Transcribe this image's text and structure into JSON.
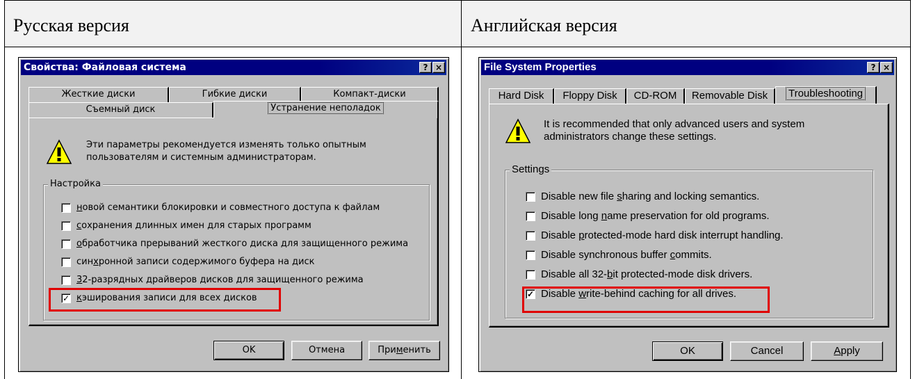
{
  "columns": {
    "left_header": "Русская версия",
    "right_header": "Английская версия"
  },
  "ru": {
    "title": "Свойства: Файловая система",
    "help_button": "?",
    "close_button": "×",
    "tabs_row1": [
      "Жесткие диски",
      "Гибкие диски",
      "Компакт-диски"
    ],
    "tabs_row2": [
      "Съемный диск",
      "Устранение неполадок"
    ],
    "warning_line1": "Эти параметры рекомендуется изменять только опытным",
    "warning_line2": "пользователям и системным администраторам.",
    "group_label": "Настройка",
    "options": [
      {
        "pre": "",
        "u": "н",
        "post": "овой семантики блокировки и совместного доступа к файлам",
        "checked": false
      },
      {
        "pre": "",
        "u": "с",
        "post": "охранения длинных имен для старых программ",
        "checked": false
      },
      {
        "pre": "",
        "u": "о",
        "post": "бработчика прерываний жесткого диска для защищенного режима",
        "checked": false
      },
      {
        "pre": "син",
        "u": "х",
        "post": "ронной записи содержимого буфера на диск",
        "checked": false
      },
      {
        "pre": "",
        "u": "3",
        "post": "2-разрядных драйверов дисков для защищенного режима",
        "checked": false
      },
      {
        "pre": "",
        "u": "к",
        "post": "эширования записи для всех дисков",
        "checked": true
      }
    ],
    "buttons": {
      "ok": "OK",
      "cancel": "Отмена",
      "apply_pre": "При",
      "apply_u": "м",
      "apply_post": "енить"
    }
  },
  "en": {
    "title": "File System Properties",
    "help_button": "?",
    "close_button": "×",
    "tabs": [
      "Hard Disk",
      "Floppy Disk",
      "CD-ROM",
      "Removable Disk",
      "Troubleshooting"
    ],
    "warning_line1": "It is recommended that only advanced users and system",
    "warning_line2": "administrators change these settings.",
    "group_label": "Settings",
    "options": [
      {
        "pre": "Disable new file ",
        "u": "s",
        "post": "haring and locking semantics.",
        "checked": false
      },
      {
        "pre": "Disable long ",
        "u": "n",
        "post": "ame preservation for old programs.",
        "checked": false
      },
      {
        "pre": "Disable ",
        "u": "p",
        "post": "rotected-mode hard disk interrupt handling.",
        "checked": false
      },
      {
        "pre": "Disable synchronous buffer ",
        "u": "c",
        "post": "ommits.",
        "checked": false
      },
      {
        "pre": "Disable all 32-",
        "u": "b",
        "post": "it protected-mode disk drivers.",
        "checked": false
      },
      {
        "pre": "Disable ",
        "u": "w",
        "post": "rite-behind caching for all drives.",
        "checked": true
      }
    ],
    "buttons": {
      "ok": "OK",
      "cancel": "Cancel",
      "apply_pre": "",
      "apply_u": "A",
      "apply_post": "pply"
    }
  },
  "colors": {
    "titlebar": "#000080",
    "highlight": "#e00000",
    "dialog_face": "#c0c0c0",
    "header_fill": "#f2f2f2"
  }
}
